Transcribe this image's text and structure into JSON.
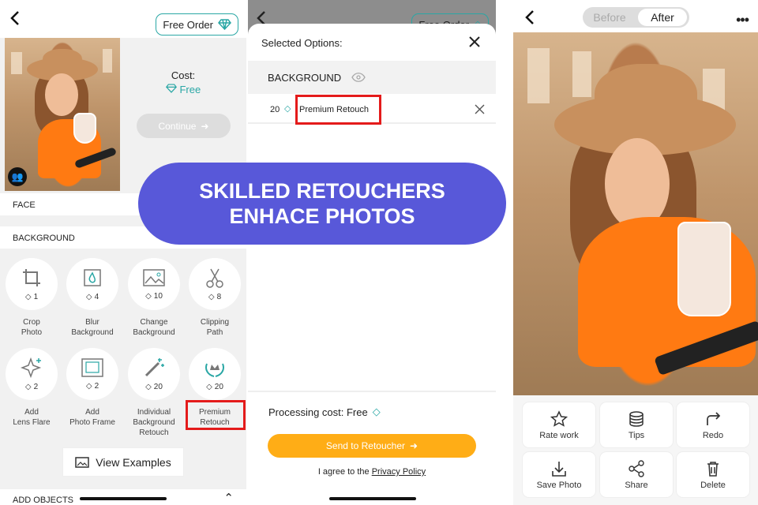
{
  "left": {
    "free_order_label": "Free Order",
    "cost_label": "Cost:",
    "cost_value": "Free",
    "continue_label": "Continue",
    "face_section": "FACE",
    "background_section": "BACKGROUND",
    "tools": [
      {
        "count": "1",
        "line1": "Crop",
        "line2": "Photo",
        "line3": ""
      },
      {
        "count": "4",
        "line1": "Blur",
        "line2": "Background",
        "line3": ""
      },
      {
        "count": "10",
        "line1": "Change",
        "line2": "Background",
        "line3": ""
      },
      {
        "count": "8",
        "line1": "Clipping",
        "line2": "Path",
        "line3": ""
      },
      {
        "count": "2",
        "line1": "Add",
        "line2": "Lens Flare",
        "line3": ""
      },
      {
        "count": "2",
        "line1": "Add",
        "line2": "Photo Frame",
        "line3": ""
      },
      {
        "count": "20",
        "line1": "Individual",
        "line2": "Background",
        "line3": "Retouch"
      },
      {
        "count": "20",
        "line1": "Premium",
        "line2": "Retouch",
        "line3": ""
      }
    ],
    "view_examples_label": "View Examples",
    "add_objects_label": "ADD OBJECTS"
  },
  "middle": {
    "free_order_label": "Free Order",
    "sheet_title": "Selected Options:",
    "section_label": "BACKGROUND",
    "option_count": "20",
    "option_label": "Premium Retouch",
    "processing_cost": "Processing cost: Free",
    "send_label": "Send to Retoucher",
    "agree_text": "I agree to the",
    "policy_link": "Privacy Policy"
  },
  "right": {
    "before_label": "Before",
    "after_label": "After",
    "actions": [
      "Rate work",
      "Tips",
      "Redo",
      "Save Photo",
      "Share",
      "Delete"
    ]
  },
  "banner": {
    "line1": "SKILLED RETOUCHERS",
    "line2": "ENHACE PHOTOS"
  },
  "colors": {
    "accent_teal": "#2aa7a5",
    "highlight_red": "#e41b1b",
    "send_orange": "#ffad16",
    "banner_purple": "#5858d9"
  }
}
